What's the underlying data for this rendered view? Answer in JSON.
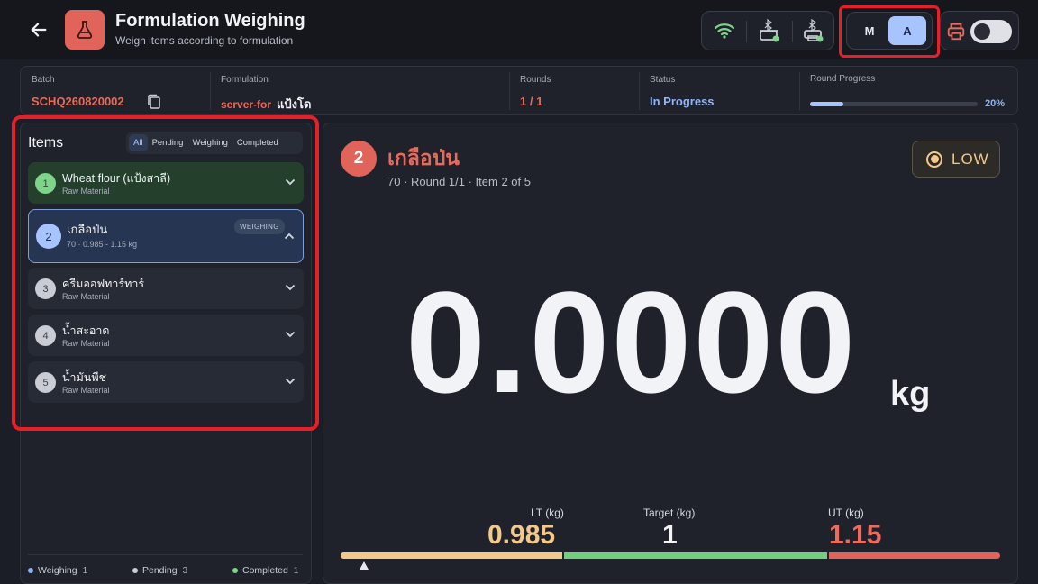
{
  "header": {
    "title": "Formulation Weighing",
    "subtitle": "Weigh items according to formulation",
    "mode_manual_label": "M",
    "mode_auto_label": "A",
    "icons": {
      "back": "arrow-left-icon",
      "app": "flask-icon",
      "wifi": "wifi-icon",
      "scale_bt": "bluetooth-scale-icon",
      "printer_bt": "bluetooth-printer-icon",
      "print": "printer-icon"
    }
  },
  "info": {
    "batch_label": "Batch",
    "batch_value": "SCHQ260820002",
    "formulation_label": "Formulation",
    "formulation_tag": "server-for",
    "formulation_name": "แป้งโด",
    "rounds_label": "Rounds",
    "rounds_value": "1 / 1",
    "status_label": "Status",
    "status_value": "In Progress",
    "progress_label": "Round Progress",
    "progress_percent": 20,
    "progress_text": "20%"
  },
  "items_panel": {
    "title": "Items",
    "filters": [
      "All",
      "Pending",
      "Weighing",
      "Completed"
    ],
    "active_filter": "All",
    "items": [
      {
        "num": "1",
        "name": "Wheat flour (แป้งสาลี)",
        "sub": "Raw Material",
        "state": "completed"
      },
      {
        "num": "2",
        "name": "เกลือป่น",
        "sub": "70 · 0.985 - 1.15 kg",
        "state": "weighing",
        "badge": "WEIGHING"
      },
      {
        "num": "3",
        "name": "ครีมออฟทาร์ทาร์",
        "sub": "Raw Material",
        "state": "pending"
      },
      {
        "num": "4",
        "name": "น้ำสะอาด",
        "sub": "Raw Material",
        "state": "pending"
      },
      {
        "num": "5",
        "name": "น้ำมันพืช",
        "sub": "Raw Material",
        "state": "pending"
      }
    ],
    "legend": [
      {
        "label": "Weighing",
        "count": "1",
        "color": "#8fb0f0"
      },
      {
        "label": "Pending",
        "count": "3",
        "color": "#c9ccd4"
      },
      {
        "label": "Completed",
        "count": "1",
        "color": "#7fd38a"
      }
    ]
  },
  "current": {
    "num": "2",
    "name": "เกลือป่น",
    "sub": "70 · Round 1/1 · Item 2 of 5",
    "status": "LOW",
    "weight": "0.0000",
    "unit": "kg",
    "lt_label": "LT (kg)",
    "lt_value": "0.985",
    "target_label": "Target (kg)",
    "target_value": "1",
    "ut_label": "UT (kg)",
    "ut_value": "1.15"
  },
  "colors": {
    "accent": "#a8c4ff",
    "brand_red": "#e0645a",
    "low": "#f3c98b",
    "ok": "#7fd38a",
    "over": "#e0645a"
  }
}
